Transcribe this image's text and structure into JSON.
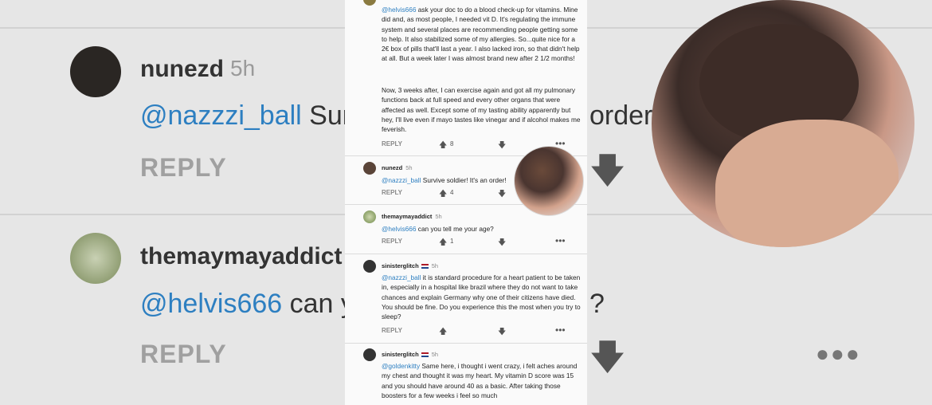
{
  "background_feed": {
    "rows": [
      {
        "name": "nunezd",
        "time": "5h",
        "mention": "@nazzzi_ball",
        "text_visible": " Sur",
        "text_trailing": "order!",
        "reply": "REPLY"
      },
      {
        "name": "themaymayaddict",
        "time": "5h",
        "mention": "@helvis666",
        "text_visible": " can y",
        "text_trailing": "?",
        "reply": "REPLY"
      }
    ]
  },
  "comments": [
    {
      "name": "",
      "time": "",
      "mention": "@helvis666",
      "body": " ask your doc to do a blood check-up for vitamins. Mine did and, as most people, I needed vit D. It's regulating the immune system and several places are recommending people getting some to help. It also stabilized some of my allergies. So...quite nice for a 2€ box of pills that'll last a year. I also lacked iron, so that didn't help at all. But a week later I was almost brand new after 2 1/2 months!",
      "body2": "Now, 3 weeks after, I can exercise again and got all my pulmonary functions back at full speed and every other organs that were affected as well. Except some of my tasting ability apparently but hey, I'll live even if mayo tastes like vinegar and if alcohol makes me feverish.",
      "reply": "REPLY",
      "votes": "8"
    },
    {
      "name": "nunezd",
      "time": "5h",
      "mention": "@nazzzi_ball",
      "body": " Survive soldier! It's an order!",
      "reply": "REPLY",
      "votes": "4"
    },
    {
      "name": "themaymayaddict",
      "time": "5h",
      "mention": "@helvis666",
      "body": " can you tell me your age?",
      "reply": "REPLY",
      "votes": "1"
    },
    {
      "name": "sinisterglitch",
      "time": "5h",
      "mention": "@nazzzi_ball",
      "body": " it is standard procedure for a heart patient to be taken in, especially in a hospital like brazil where they do not want to take chances and explain Germany why one of their citizens have died. You should be fine. Do you experience this the most when you try to sleep?",
      "reply": "REPLY",
      "votes": ""
    },
    {
      "name": "sinisterglitch",
      "time": "5h",
      "mention": "@goldenkitty",
      "body": " Same here, i thought i went crazy, i felt aches around my chest and thought it was my heart. My vitamin D score was 15 and you should have around 40 as a basic. After taking those boosters for a few weeks i feel so much",
      "reply": "",
      "votes": ""
    }
  ],
  "icons": {
    "upvote": "arrow-up-icon",
    "downvote": "arrow-down-icon",
    "more": "more-options-icon"
  }
}
